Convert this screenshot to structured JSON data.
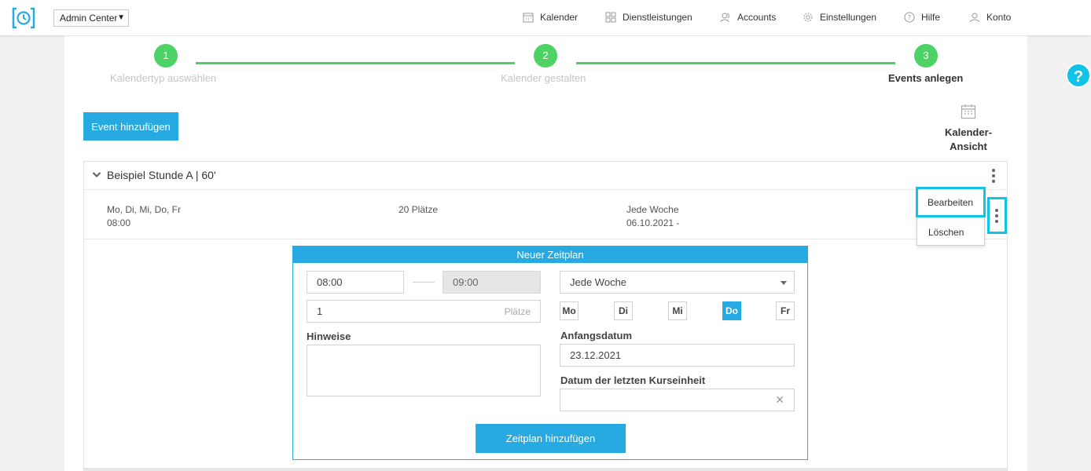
{
  "topbar": {
    "admin_select": "Admin Center",
    "nav": [
      {
        "label": "Kalender",
        "icon": "calendar-icon"
      },
      {
        "label": "Dienstleistungen",
        "icon": "grid-icon"
      },
      {
        "label": "Accounts",
        "icon": "users-icon"
      },
      {
        "label": "Einstellungen",
        "icon": "gear-icon"
      },
      {
        "label": "Hilfe",
        "icon": "help-icon"
      },
      {
        "label": "Konto",
        "icon": "user-icon"
      }
    ]
  },
  "stepper": {
    "steps": [
      {
        "number": "1",
        "label": "Kalendertyp auswählen"
      },
      {
        "number": "2",
        "label": "Kalender gestalten"
      },
      {
        "number": "3",
        "label": "Events anlegen"
      }
    ]
  },
  "toolbar": {
    "add_event_label": "Event hinzufügen",
    "calendar_view_label": "Kalender-Ansicht"
  },
  "event": {
    "title": "Beispiel Stunde A | 60'",
    "schedule": {
      "days": "Mo, Di, Mi, Do, Fr",
      "time": "08:00",
      "places": "20 Plätze",
      "repeat": "Jede Woche",
      "date_range": "06.10.2021 -"
    }
  },
  "menu": {
    "edit_label": "Bearbeiten",
    "delete_label": "Löschen"
  },
  "form": {
    "title": "Neuer Zeitplan",
    "start_time": "08:00",
    "end_time": "09:00",
    "places_value": "1",
    "places_suffix": "Plätze",
    "repeat_value": "Jede Woche",
    "days": [
      {
        "label": "Mo",
        "selected": false
      },
      {
        "label": "Di",
        "selected": false
      },
      {
        "label": "Mi",
        "selected": false
      },
      {
        "label": "Do",
        "selected": true
      },
      {
        "label": "Fr",
        "selected": false
      }
    ],
    "notes_label": "Hinweise",
    "start_date_label": "Anfangsdatum",
    "start_date_value": "23.12.2021",
    "last_date_label": "Datum der letzten Kurseinheit",
    "last_date_value": "",
    "submit_label": "Zeitplan hinzufügen"
  },
  "help_badge": "?",
  "colors": {
    "accent": "#27aae1",
    "step_green": "#4cd265",
    "highlight": "#12c3e8"
  }
}
